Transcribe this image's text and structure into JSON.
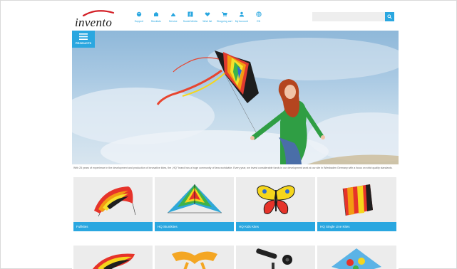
{
  "brand": {
    "logo_text": "invento",
    "accent": "#2aa7e0",
    "swoosh_color": "#d31f26"
  },
  "nav": [
    {
      "label": "Support",
      "icon": "support-icon"
    },
    {
      "label": "Stockists",
      "icon": "stockists-icon"
    },
    {
      "label": "Service",
      "icon": "service-icon"
    },
    {
      "label": "Social Media",
      "icon": "facebook-icon"
    },
    {
      "label": "Wish list",
      "icon": "heart-icon"
    },
    {
      "label": "Shopping cart",
      "icon": "cart-icon"
    },
    {
      "label": "My Account",
      "icon": "user-icon"
    },
    {
      "label": "EN",
      "icon": "globe-icon"
    }
  ],
  "search": {
    "placeholder": ""
  },
  "products_button": {
    "label": "PRODUCTS"
  },
  "intro_text": "With 25 years of experience in the development and production of innovative kites, the „HQ\" brand has a huge community of fans worldwide. Every year, we invest considerable funds in our development work at our site in Wiesbaden Germany with a focus on strict quality standards.",
  "tiles": [
    {
      "label": "Fullkites"
    },
    {
      "label": "HQ Stuntkites"
    },
    {
      "label": "HQ Kids Kites"
    },
    {
      "label": "HQ Single Line Kites"
    }
  ]
}
